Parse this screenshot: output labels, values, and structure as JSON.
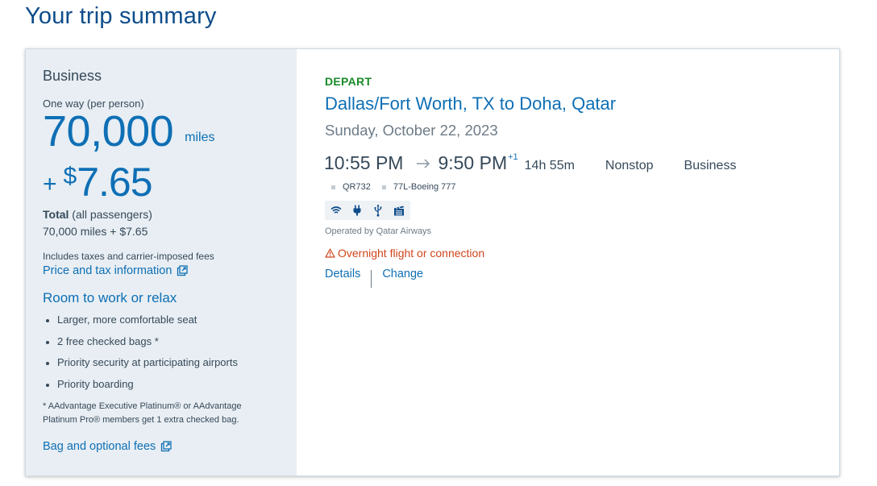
{
  "page": {
    "title": "Your trip summary"
  },
  "fare_panel": {
    "cabin": "Business",
    "fare_type": "One way (per person)",
    "miles": "70,000",
    "miles_unit": "miles",
    "cash_plus": "+",
    "cash_currency": "$",
    "cash_amount": "7.65",
    "total_label": "Total",
    "total_suffix": "(all passengers)",
    "total_value": "70,000 miles + $7.65",
    "taxes_note": "Includes taxes and carrier-imposed fees",
    "price_tax_link": "Price and tax information",
    "perks_title": "Room to work or relax",
    "perks": [
      "Larger, more comfortable seat",
      "2 free checked bags *",
      "Priority security at participating airports",
      "Priority boarding"
    ],
    "footnote": "* AAdvantage Executive Platinum® or AAdvantage Platinum Pro® members get 1 extra checked bag.",
    "bag_fees_link": "Bag and optional fees",
    "icons": {
      "external_link": "external-link-icon"
    }
  },
  "flight": {
    "label": "DEPART",
    "route": "Dallas/Fort Worth, TX to Doha, Qatar",
    "date": "Sunday, October 22, 2023",
    "depart_time": "10:55 PM",
    "arrive_time": "9:50 PM",
    "plus_day": "+1",
    "duration": "14h 55m",
    "stops": "Nonstop",
    "cabin": "Business",
    "flight_number": "QR732",
    "aircraft": "77L-Boeing 777",
    "amenities": [
      "wifi-icon",
      "power-outlet-icon",
      "usb-icon",
      "entertainment-icon"
    ],
    "operated_by": "Operated by Qatar Airways",
    "warning": "Overnight flight or connection",
    "details_link": "Details",
    "change_link": "Change"
  },
  "colors": {
    "title_blue": "#0e4c8a",
    "link_blue": "#0e6fb5",
    "depart_green": "#1b8a29",
    "warning_orange": "#d0451b",
    "panel_bg": "#e8eef3"
  }
}
